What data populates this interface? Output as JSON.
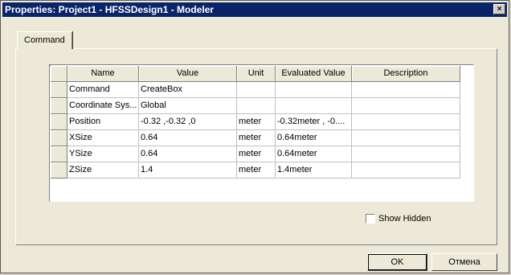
{
  "window": {
    "title": "Properties: Project1 - HFSSDesign1 - Modeler",
    "close_label": "×"
  },
  "tabs": [
    {
      "label": "Command"
    }
  ],
  "table": {
    "columns": [
      "Name",
      "Value",
      "Unit",
      "Evaluated Value",
      "Description"
    ],
    "rows": [
      [
        "Command",
        "CreateBox",
        "",
        "",
        ""
      ],
      [
        "Coordinate Sys...",
        "Global",
        "",
        "",
        ""
      ],
      [
        "Position",
        "-0.32 ,-0.32 ,0",
        "meter",
        "-0.32meter , -0....",
        ""
      ],
      [
        "XSize",
        "0.64",
        "meter",
        "0.64meter",
        ""
      ],
      [
        "YSize",
        "0.64",
        "meter",
        "0.64meter",
        ""
      ],
      [
        "ZSize",
        "1.4",
        "meter",
        "1.4meter",
        ""
      ]
    ]
  },
  "show_hidden": {
    "label": "Show Hidden",
    "checked": false
  },
  "buttons": {
    "ok": "OK",
    "cancel": "Отмена"
  }
}
